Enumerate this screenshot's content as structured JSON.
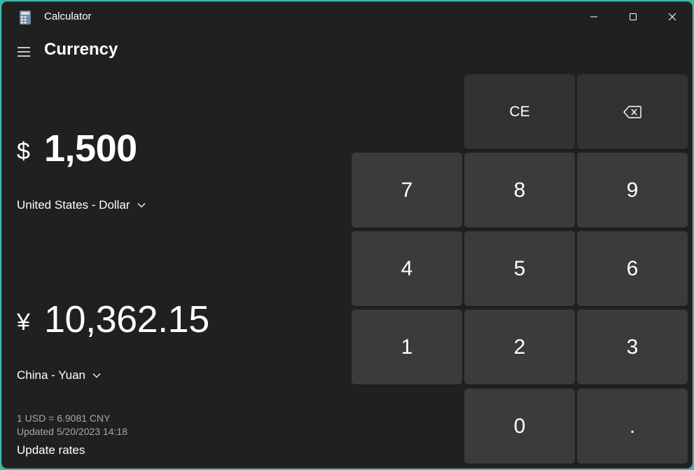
{
  "window": {
    "title": "Calculator",
    "minimize_icon": "minimize-icon",
    "maximize_icon": "maximize-icon",
    "close_icon": "close-icon"
  },
  "header": {
    "menu_icon": "hamburger-menu-icon",
    "mode": "Currency"
  },
  "from": {
    "symbol": "$",
    "amount": "1,500",
    "currency": "United States - Dollar"
  },
  "to": {
    "symbol": "¥",
    "amount": "10,362.15",
    "currency": "China - Yuan"
  },
  "rates": {
    "rate": "1 USD = 6.9081 CNY",
    "updated": "Updated 5/20/2023 14:18",
    "update_link": "Update rates"
  },
  "keypad": {
    "ce": "CE",
    "backspace_icon": "backspace-icon",
    "k7": "7",
    "k8": "8",
    "k9": "9",
    "k4": "4",
    "k5": "5",
    "k6": "6",
    "k1": "1",
    "k2": "2",
    "k3": "3",
    "k0": "0",
    "decimal": "."
  },
  "colors": {
    "background": "#202020",
    "key": "#3b3b3b",
    "function_key": "#323232",
    "text": "#ffffff",
    "secondary_text": "#a8a8a8"
  }
}
